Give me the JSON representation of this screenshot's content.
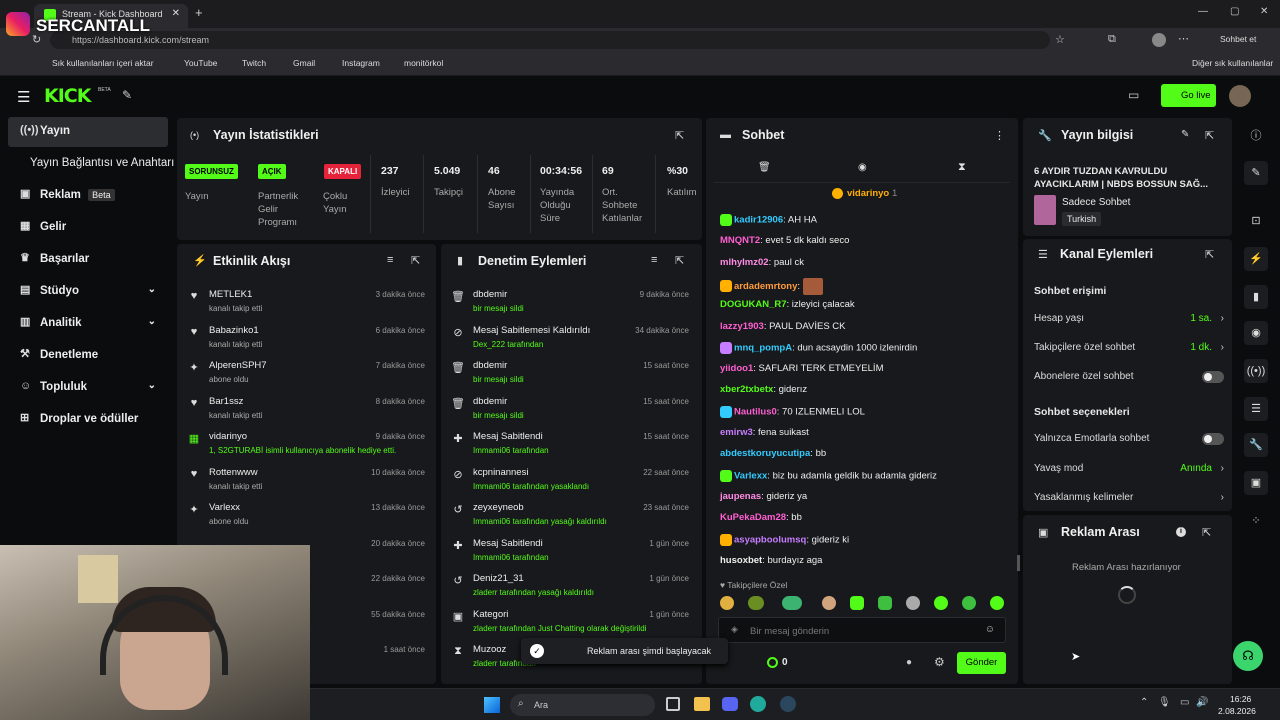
{
  "browser": {
    "tab_title": "Stream - Kick Dashboard",
    "overlay_name": "SERCANTALL",
    "url": "https://dashboard.kick.com/stream",
    "profile_btn": "Sohbet et",
    "bookmarks": [
      "Sık kullanılanları içeri aktar",
      "YouTube",
      "Twitch",
      "Gmail",
      "Instagram",
      "monitörkol"
    ],
    "other_bookmarks": "Diğer sık kullanılanlar"
  },
  "app": {
    "logo": "KICK",
    "beta_tag": "BETA",
    "go_live": "Go live"
  },
  "sidebar": {
    "items": [
      {
        "label": "Yayın",
        "icon": "broadcast-icon"
      },
      {
        "label": "Yayın Bağlantısı ve Anahtarı",
        "icon": ""
      },
      {
        "label": "Reklam",
        "badge": "Beta",
        "icon": "ad-icon"
      },
      {
        "label": "Gelir",
        "icon": "money-icon"
      },
      {
        "label": "Başarılar",
        "icon": "trophy-icon"
      },
      {
        "label": "Stüdyo",
        "icon": "studio-icon"
      },
      {
        "label": "Analitik",
        "icon": "chart-icon"
      },
      {
        "label": "Denetleme",
        "icon": "hammer-icon"
      },
      {
        "label": "Topluluk",
        "icon": "community-icon"
      },
      {
        "label": "Droplar ve ödüller",
        "icon": "gift-icon"
      }
    ]
  },
  "stats": {
    "title": "Yayın İstatistikleri",
    "status": [
      {
        "pill": "SORUNSUZ",
        "label": "Yayın"
      },
      {
        "pill": "AÇIK",
        "label": "Partnerlik Gelir Programı"
      },
      {
        "pill": "KAPALI",
        "label": "Çoklu Yayın"
      }
    ],
    "numbers": [
      {
        "value": "237",
        "label": "İzleyici"
      },
      {
        "value": "5.049",
        "label": "Takipçi"
      },
      {
        "value": "46",
        "label": "Abone Sayısı"
      },
      {
        "value": "00:34:56",
        "label": "Yayında Olduğu Süre"
      },
      {
        "value": "69",
        "label": "Ort. Sohbete Katılanlar"
      },
      {
        "value": "%30",
        "label": "Katılım"
      }
    ]
  },
  "activity": {
    "title": "Etkinlik Akışı",
    "rows": [
      {
        "name": "METLEK1",
        "sub": "kanalı takip etti",
        "time": "3 dakika önce",
        "icon": "heart-icon"
      },
      {
        "name": "Babazinko1",
        "sub": "kanalı takip etti",
        "time": "6 dakika önce",
        "icon": "heart-icon"
      },
      {
        "name": "AlperenSPH7",
        "sub": "abone oldu",
        "time": "7 dakika önce",
        "icon": "star-icon"
      },
      {
        "name": "Bar1ssz",
        "sub": "kanalı takip etti",
        "time": "8 dakika önce",
        "icon": "heart-icon"
      },
      {
        "name": "vidarinyo",
        "sub": "1, S2GTURABİ isimli kullanıcıya abonelik hediye etti.",
        "time": "9 dakika önce",
        "icon": "gift-icon"
      },
      {
        "name": "Rottenwww",
        "sub": "kanalı takip etti",
        "time": "10 dakika önce",
        "icon": "heart-icon"
      },
      {
        "name": "Varlexx",
        "sub": "abone oldu",
        "time": "13 dakika önce",
        "icon": "star-icon"
      },
      {
        "name": "",
        "sub": "",
        "time": "20 dakika önce",
        "icon": ""
      },
      {
        "name": "",
        "sub": "",
        "time": "22 dakika önce",
        "icon": ""
      },
      {
        "name": "",
        "sub": "",
        "time": "55 dakika önce",
        "icon": ""
      },
      {
        "name": "",
        "sub": "",
        "time": "1 saat önce",
        "icon": ""
      }
    ]
  },
  "moderation": {
    "title": "Denetim Eylemleri",
    "rows": [
      {
        "name": "dbdemir",
        "sub": "bir mesajı sildi",
        "time": "9 dakika önce",
        "icon": "trash-icon"
      },
      {
        "name": "Mesaj Sabitlemesi Kaldırıldı",
        "sub": "Dex_222 tarafından",
        "time": "34 dakika önce",
        "icon": "unpin-icon"
      },
      {
        "name": "dbdemir",
        "sub": "bir mesajı sildi",
        "time": "15 saat önce",
        "icon": "trash-icon"
      },
      {
        "name": "dbdemir",
        "sub": "bir mesajı sildi",
        "time": "15 saat önce",
        "icon": "trash-icon"
      },
      {
        "name": "Mesaj Sabitlendi",
        "sub": "Immami06 tarafından",
        "time": "15 saat önce",
        "icon": "pin-icon"
      },
      {
        "name": "kcpninannesi",
        "sub": "Immami06 tarafından yasaklandı",
        "time": "22 saat önce",
        "icon": "ban-icon"
      },
      {
        "name": "zeyxeyneob",
        "sub": "Immami06 tarafından yasağı kaldırıldı",
        "time": "23 saat önce",
        "icon": "unban-icon"
      },
      {
        "name": "Mesaj Sabitlendi",
        "sub": "Immami06 tarafından",
        "time": "1 gün önce",
        "icon": "pin-icon"
      },
      {
        "name": "Deniz21_31",
        "sub": "zladerr tarafından yasağı kaldırıldı",
        "time": "1 gün önce",
        "icon": "unban-icon"
      },
      {
        "name": "Kategori",
        "sub": "zladerr tarafından Just Chatting olarak değiştirildi",
        "time": "1 gün önce",
        "icon": "category-icon"
      },
      {
        "name": "Muzooz",
        "sub": "zladerr tarafından",
        "time": "",
        "icon": "timeout-icon"
      }
    ]
  },
  "chat": {
    "title": "Sohbet",
    "pinned_user": "vidarinyo",
    "pinned_count": "1",
    "messages": [
      {
        "user": "kadir12906",
        "color": "#3cf",
        "text": "AH HA"
      },
      {
        "user": "MNQNT2",
        "color": "#ff5fd2",
        "text": "evet 5 dk kaldı seco"
      },
      {
        "user": "mlhyImz02",
        "color": "#ff8ce6",
        "text": "paul ck"
      },
      {
        "user": "ardademrtony",
        "color": "#ff9c3d",
        "text": ""
      },
      {
        "user": "DOGUKAN_R7",
        "color": "#53fc18",
        "text": "izleyici çalacak"
      },
      {
        "user": "lazzy1903",
        "color": "#ff5fd2",
        "text": "PAUL DAVİES CK"
      },
      {
        "user": "mnq_pompA",
        "color": "#3cf",
        "text": "dun acsaydin 1000 izlenirdin"
      },
      {
        "user": "yiidoo1",
        "color": "#ff5fd2",
        "text": "SAFLARI TERK ETMEYELİM"
      },
      {
        "user": "xber2txbetx",
        "color": "#53fc18",
        "text": "giderız"
      },
      {
        "user": "Nautilus0",
        "color": "#ff5fd2",
        "text": "70 IZLENMELI LOL"
      },
      {
        "user": "emirw3",
        "color": "#c77dff",
        "text": "fena suikast"
      },
      {
        "user": "abdestkoruyucutipa",
        "color": "#3cf",
        "text": "bb"
      },
      {
        "user": "Varlexx",
        "color": "#3cf",
        "text": "biz bu adamla geldik bu adamla gideriz"
      },
      {
        "user": "jaupenas",
        "color": "#ff8ce6",
        "text": "gideriz ya"
      },
      {
        "user": "KuPekaDam28",
        "color": "#ff5fd2",
        "text": "bb"
      },
      {
        "user": "asyapboolumsq",
        "color": "#c77dff",
        "text": "gideriz ki"
      },
      {
        "user": "husoxbet",
        "color": "#eeeeee",
        "text": "burdayız aga"
      }
    ],
    "followers_only": "Takipçilere Özel",
    "input_placeholder": "Bir mesaj gönderin",
    "points": "0",
    "send": "Gönder"
  },
  "stream_info": {
    "title": "Yayın bilgisi",
    "stream_title": "6 AYDIR TUZDAN KAVRULDU AYACIKLARIM | NBDS BOSSUN SAĞ...",
    "category": "Sadece Sohbet",
    "language": "Turkish"
  },
  "channel_actions": {
    "title": "Kanal Eylemleri",
    "chat_access": "Sohbet erişimi",
    "access_rows": [
      {
        "label": "Hesap yaşı",
        "value": "1 sa."
      },
      {
        "label": "Takipçilere özel sohbet",
        "value": "1 dk."
      },
      {
        "label": "Abonelere özel sohbet",
        "value": ""
      }
    ],
    "chat_options": "Sohbet seçenekleri",
    "option_rows": [
      {
        "label": "Yalnızca Emotlarla sohbet",
        "value": ""
      },
      {
        "label": "Yavaş mod",
        "value": "Anında"
      },
      {
        "label": "Yasaklanmış kelimeler",
        "value": ""
      }
    ]
  },
  "ad_break": {
    "title": "Reklam Arası",
    "status": "Reklam Arası hazırlanıyor"
  },
  "toast": {
    "text": "Reklam arası şimdi başlayacak"
  },
  "taskbar": {
    "search": "Ara",
    "time": "16:26",
    "date": "2.08.2026"
  },
  "colors": {
    "accent": "#53fc18",
    "panel": "#18191c",
    "bg": "#0b0c0d"
  }
}
